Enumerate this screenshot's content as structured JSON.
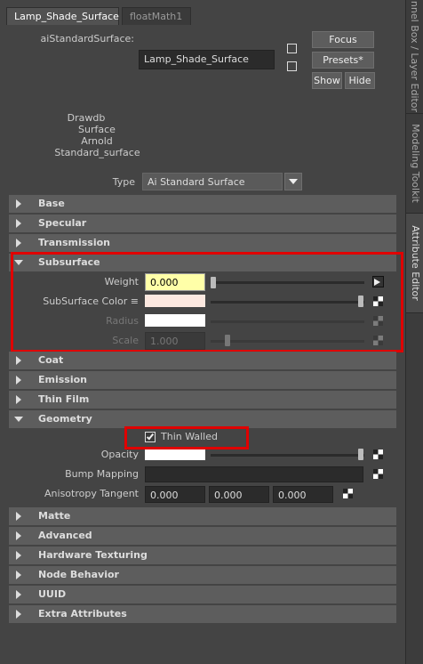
{
  "tabs": [
    {
      "label": "Lamp_Shade_Surface",
      "active": true
    },
    {
      "label": "floatMath1",
      "active": false
    }
  ],
  "header": {
    "node_type_label": "aiStandardSurface:",
    "node_name": "Lamp_Shade_Surface",
    "focus_label": "Focus",
    "presets_label": "Presets*",
    "show_label": "Show",
    "hide_label": "Hide",
    "classification": [
      "Drawdb",
      "Surface",
      "Arnold",
      "Standard_surface"
    ],
    "type_label": "Type",
    "type_value": "Ai Standard Surface"
  },
  "side_tabs": [
    "nnel Box / Layer Editor",
    "Modeling Toolkit",
    "Attribute Editor"
  ],
  "sections": {
    "base": "Base",
    "specular": "Specular",
    "transmission": "Transmission",
    "subsurface": "Subsurface",
    "coat": "Coat",
    "emission": "Emission",
    "thin_film": "Thin Film",
    "geometry": "Geometry",
    "matte": "Matte",
    "advanced": "Advanced",
    "hardware_texturing": "Hardware Texturing",
    "node_behavior": "Node Behavior",
    "uuid": "UUID",
    "extra_attributes": "Extra Attributes"
  },
  "subsurface": {
    "weight_label": "Weight",
    "weight_value": "0.000",
    "color_label": "SubSurface Color ≡",
    "radius_label": "Radius",
    "scale_label": "Scale",
    "scale_value": "1.000"
  },
  "geometry": {
    "thin_walled_label": "Thin Walled",
    "thin_walled_checked": true,
    "opacity_label": "Opacity",
    "bump_label": "Bump Mapping",
    "aniso_label": "Anisotropy Tangent",
    "aniso_values": [
      "0.000",
      "0.000",
      "0.000"
    ]
  },
  "colors": {
    "weight_field_bg": "#ffffa8",
    "subsurface_color": "#fce8e0",
    "highlight": "#e00000"
  }
}
